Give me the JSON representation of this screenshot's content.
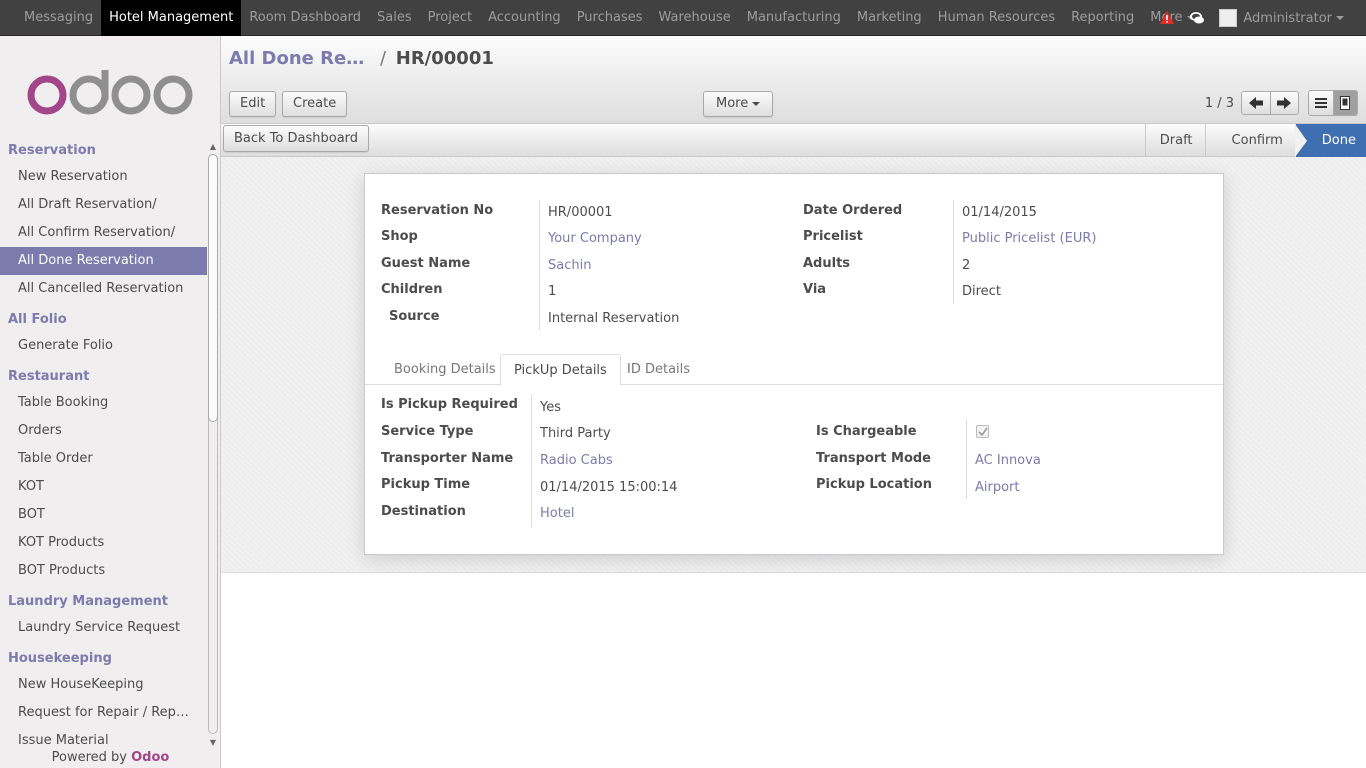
{
  "topbar": {
    "menu": [
      "Messaging",
      "Hotel Management",
      "Room Dashboard",
      "Sales",
      "Project",
      "Accounting",
      "Purchases",
      "Warehouse",
      "Manufacturing",
      "Marketing",
      "Human Resources",
      "Reporting",
      "More"
    ],
    "user": "Administrator"
  },
  "sidebar": {
    "sections": [
      {
        "title": "Reservation",
        "items": [
          "New Reservation",
          "All Draft Reservation/",
          "All Confirm Reservation/",
          "All Done Reservation",
          "All Cancelled Reservation"
        ]
      },
      {
        "title": "All Folio",
        "items": [
          "Generate Folio"
        ]
      },
      {
        "title": "Restaurant",
        "items": [
          "Table Booking",
          "Orders",
          "Table Order",
          "KOT",
          "BOT",
          "KOT Products",
          "BOT Products"
        ]
      },
      {
        "title": "Laundry Management",
        "items": [
          "Laundry Service Request"
        ]
      },
      {
        "title": "Housekeeping",
        "items": [
          "New HouseKeeping",
          "Request for Repair / Rep…",
          "Issue Material"
        ]
      }
    ],
    "powered_by": "Powered by",
    "powered_brand": "Odoo"
  },
  "control_panel": {
    "breadcrumb_parent": "All Done Re…",
    "breadcrumb_separator": "/",
    "breadcrumb_current": "HR/00001",
    "edit_label": "Edit",
    "create_label": "Create",
    "more_label": "More",
    "pager": "1 / 3"
  },
  "statusbar": {
    "back_label": "Back To Dashboard",
    "steps": [
      "Draft",
      "Confirm",
      "Done"
    ]
  },
  "form": {
    "left": [
      {
        "label": "Reservation No",
        "value": "HR/00001"
      },
      {
        "label": "Shop",
        "value": "Your Company"
      },
      {
        "label": "Guest Name",
        "value": "Sachin"
      },
      {
        "label": "Children",
        "value": "1"
      },
      {
        "label": "Source",
        "value": "Internal Reservation"
      }
    ],
    "right": [
      {
        "label": "Date Ordered",
        "value": "01/14/2015"
      },
      {
        "label": "Pricelist",
        "value": "Public Pricelist (EUR)"
      },
      {
        "label": "Adults",
        "value": "2"
      },
      {
        "label": "Via",
        "value": "Direct"
      }
    ],
    "tabs": [
      "Booking Details",
      "PickUp Details",
      "ID Details"
    ],
    "pickup_left": [
      {
        "label": "Is Pickup Required",
        "value": "Yes"
      },
      {
        "label": "Service Type",
        "value": "Third Party"
      },
      {
        "label": "Transporter Name",
        "value": "Radio Cabs"
      },
      {
        "label": "Pickup Time",
        "value": "01/14/2015 15:00:14"
      },
      {
        "label": "Destination",
        "value": "Hotel"
      }
    ],
    "pickup_right": [
      {
        "label": "Is Chargeable",
        "checked": true
      },
      {
        "label": "Transport Mode",
        "value": "AC Innova"
      },
      {
        "label": "Pickup Location",
        "value": "Airport"
      }
    ]
  },
  "colors": {
    "accent": "#7c7bad",
    "topbar": "#414141",
    "status_active": "#3f6fb0",
    "brand": "#a24689"
  }
}
